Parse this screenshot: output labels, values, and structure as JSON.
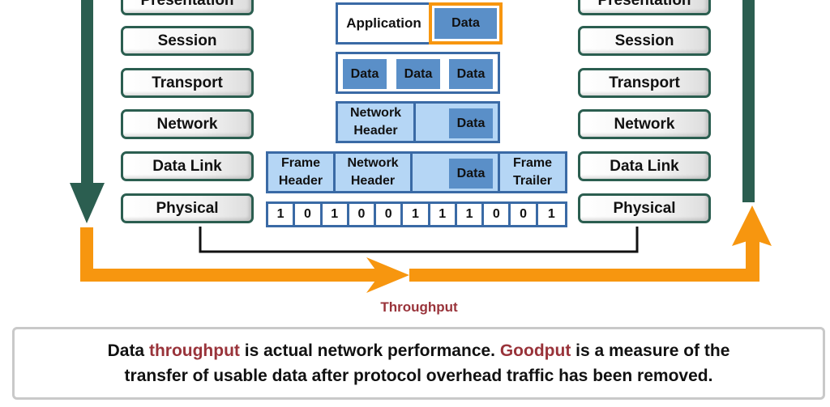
{
  "colors": {
    "layer_border": "#2b5e50",
    "down_arrow": "#2b5e50",
    "throughput_arrow": "#f7960f",
    "pdu_border": "#3a6aa5",
    "data_block": "#5a8fc8",
    "header_fill": "#b5d6f5",
    "highlight_text": "#99333a",
    "app_data_highlight": "#f7960f"
  },
  "left_stack": {
    "layers": [
      "Presentation",
      "Session",
      "Transport",
      "Network",
      "Data Link",
      "Physical"
    ]
  },
  "right_stack": {
    "layers": [
      "Presentation",
      "Session",
      "Transport",
      "Network",
      "Data Link",
      "Physical"
    ]
  },
  "encapsulation": {
    "application": {
      "label": "Application",
      "data": "Data"
    },
    "segments": [
      "Data",
      "Data",
      "Data"
    ],
    "packet": {
      "header": "Network Header",
      "data": "Data"
    },
    "frame": {
      "header": "Frame Header",
      "network_header": "Network Header",
      "data": "Data",
      "trailer": "Frame Trailer"
    },
    "bits": [
      "1",
      "0",
      "1",
      "0",
      "0",
      "1",
      "1",
      "1",
      "0",
      "0",
      "1"
    ]
  },
  "throughput_label": "Throughput",
  "caption": {
    "line1_a": "Data ",
    "line1_hl1": "throughput",
    "line1_b": " is actual network performance. ",
    "line1_hl2": "Goodput",
    "line1_c": " is a measure of the",
    "line2": "transfer of usable data after protocol overhead traffic has been removed."
  }
}
